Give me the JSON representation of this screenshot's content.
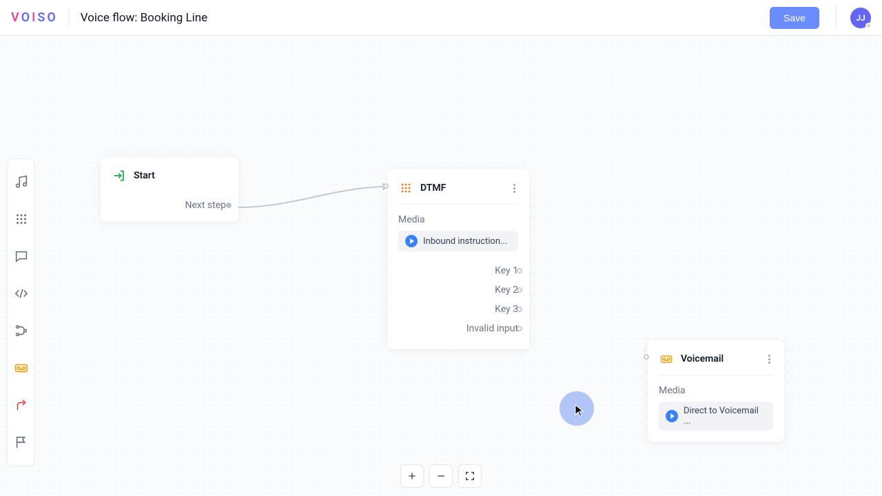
{
  "header": {
    "logo": "VOISO",
    "title": "Voice flow: Booking Line",
    "save_label": "Save",
    "avatar_initials": "JJ"
  },
  "sidebar": {
    "items": [
      {
        "name": "media-tool"
      },
      {
        "name": "dtmf-tool"
      },
      {
        "name": "chat-tool"
      },
      {
        "name": "code-tool"
      },
      {
        "name": "branch-tool"
      },
      {
        "name": "voicemail-tool"
      },
      {
        "name": "transfer-tool"
      },
      {
        "name": "flag-tool"
      }
    ]
  },
  "nodes": {
    "start": {
      "title": "Start",
      "next_label": "Next step"
    },
    "dtmf": {
      "title": "DTMF",
      "media_label": "Media",
      "media_value": "Inbound instruction...",
      "keys": [
        "Key 1",
        "Key 2",
        "Key 3",
        "Invalid input"
      ]
    },
    "voicemail": {
      "title": "Voicemail",
      "media_label": "Media",
      "media_value": "Direct to Voicemail ..."
    }
  }
}
